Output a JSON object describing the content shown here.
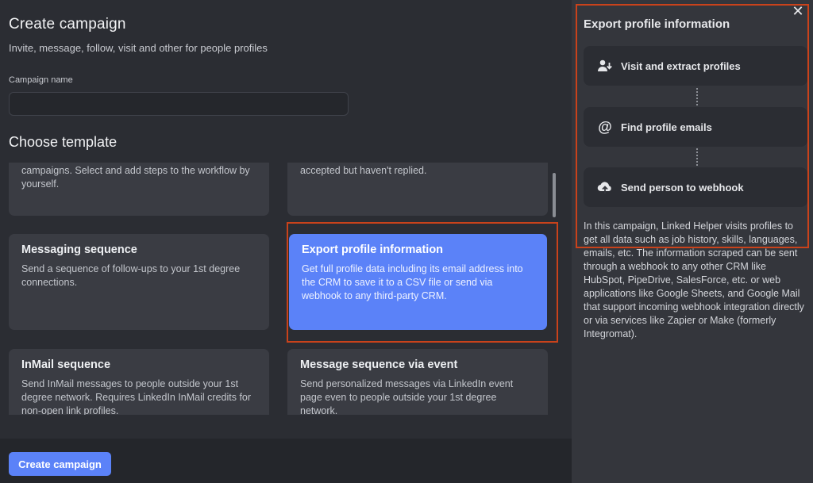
{
  "header": {
    "title": "Create campaign",
    "subtitle": "Invite, message, follow, visit and other for people profiles"
  },
  "campaign_name": {
    "label": "Campaign name",
    "value": "",
    "placeholder": ""
  },
  "choose_template": "Choose template",
  "templates": [
    {
      "title": "",
      "desc": "campaigns. Select and add steps to the workflow by yourself."
    },
    {
      "title": "",
      "desc": "accepted but haven't replied."
    },
    {
      "title": "Messaging sequence",
      "desc": "Send a sequence of follow-ups to your 1st degree connections."
    },
    {
      "title": "Export profile information",
      "desc": "Get full profile data including its email address into the CRM to save it to a CSV file or send via webhook to any third-party CRM.",
      "selected": true
    },
    {
      "title": "InMail sequence",
      "desc": "Send InMail messages to people outside your 1st degree network. Requires LinkedIn InMail credits for non-open link profiles."
    },
    {
      "title": "Message sequence via event",
      "desc": "Send personalized messages via LinkedIn event page even to people outside your 1st degree network."
    }
  ],
  "footer": {
    "create_button": "Create campaign"
  },
  "panel": {
    "title": "Export profile information",
    "close_icon": "close-icon",
    "steps": [
      {
        "label": "Visit and extract profiles",
        "icon": "users-download-icon"
      },
      {
        "label": "Find profile emails",
        "icon": "at-sign-icon"
      },
      {
        "label": "Send person to webhook",
        "icon": "cloud-upload-icon"
      }
    ],
    "description": "In this campaign, Linked Helper visits profiles to get all data such as job history, skills, languages, emails, etc. The information scraped can be sent through a webhook to any other CRM like HubSpot, PipeDrive, SalesForce, etc. or web applications like Google Sheets, and Google Mail that support incoming webhook integration directly or via services like Zapier or Make (formerly Integromat)."
  },
  "colors": {
    "accent": "#5b82f8",
    "highlight": "#c9421b",
    "background": "#2b2d33",
    "card": "#3a3c43"
  }
}
